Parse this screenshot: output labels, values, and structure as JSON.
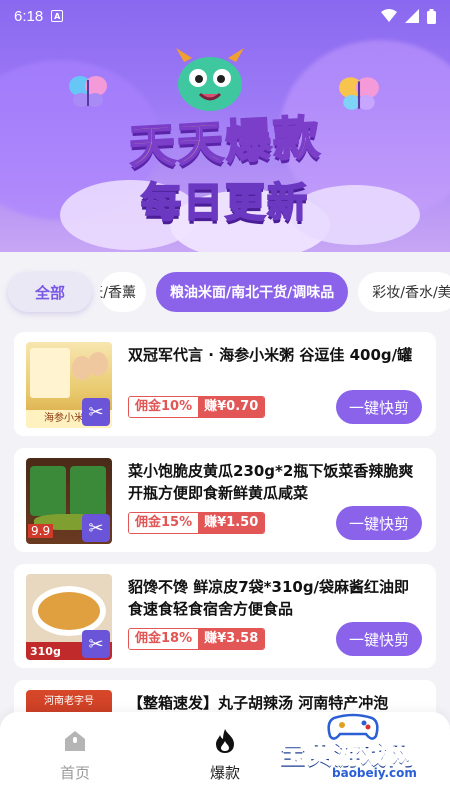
{
  "status_bar": {
    "time": "6:18",
    "notification_icon": "A"
  },
  "banner": {
    "title_line1": "天天爆款",
    "title_line2": "每日更新"
  },
  "tabs": [
    {
      "label": "全部",
      "state": "selected-style"
    },
    {
      "label": "天/香薰",
      "state": "partial"
    },
    {
      "label": "粮油米面/南北干货/调味品",
      "state": "active"
    },
    {
      "label": "彩妆/香水/美",
      "state": "partial"
    }
  ],
  "products": [
    {
      "title": "双冠军代言 · 海参小米粥 谷逗佳 400g/罐",
      "commission": "佣金10%",
      "earn": "赚¥0.70",
      "action": "一键快剪",
      "thumb_text": "海参小米粥"
    },
    {
      "title": "菜小饱脆皮黄瓜230g*2瓶下饭菜香辣脆爽开瓶方便即食新鲜黄瓜咸菜",
      "commission": "佣金15%",
      "earn": "赚¥1.50",
      "action": "一键快剪",
      "thumb_text": "9.9"
    },
    {
      "title": "貂馋不馋 鲜凉皮7袋*310g/袋麻酱红油即食速食轻食宿舍方便食品",
      "commission": "佣金18%",
      "earn": "赚¥3.58",
      "action": "一键快剪",
      "thumb_text": "310g"
    },
    {
      "title": "【整箱速发】丸子胡辣汤 河南特产冲泡",
      "thumb_text": "河南老字号"
    }
  ],
  "bottom_nav": [
    {
      "label": "首页",
      "icon": "home-icon"
    },
    {
      "label": "爆款",
      "icon": "fire-icon"
    }
  ],
  "watermark": {
    "text": "宝贝游戏网",
    "url": "baobeiy.com"
  },
  "colors": {
    "accent": "#8b63ea",
    "commission": "#e35656"
  }
}
